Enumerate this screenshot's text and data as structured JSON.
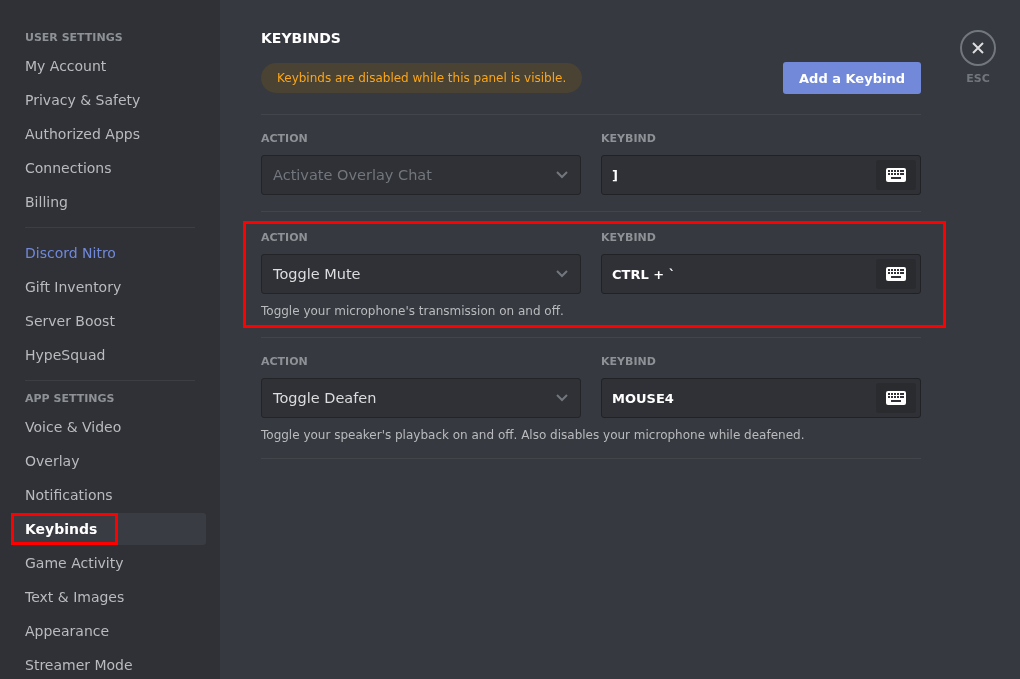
{
  "sidebar": {
    "sections": [
      {
        "header": "USER SETTINGS",
        "items": [
          {
            "label": "My Account",
            "kind": "normal",
            "selected": false,
            "highlighted": false
          },
          {
            "label": "Privacy & Safety",
            "kind": "normal",
            "selected": false,
            "highlighted": false
          },
          {
            "label": "Authorized Apps",
            "kind": "normal",
            "selected": false,
            "highlighted": false
          },
          {
            "label": "Connections",
            "kind": "normal",
            "selected": false,
            "highlighted": false
          },
          {
            "label": "Billing",
            "kind": "normal",
            "selected": false,
            "highlighted": false
          }
        ]
      },
      {
        "items": [
          {
            "label": "Discord Nitro",
            "kind": "accent",
            "selected": false,
            "highlighted": false
          },
          {
            "label": "Gift Inventory",
            "kind": "normal",
            "selected": false,
            "highlighted": false
          },
          {
            "label": "Server Boost",
            "kind": "normal",
            "selected": false,
            "highlighted": false
          },
          {
            "label": "HypeSquad",
            "kind": "normal",
            "selected": false,
            "highlighted": false
          }
        ]
      },
      {
        "header": "APP SETTINGS",
        "items": [
          {
            "label": "Voice & Video",
            "kind": "normal",
            "selected": false,
            "highlighted": false
          },
          {
            "label": "Overlay",
            "kind": "normal",
            "selected": false,
            "highlighted": false
          },
          {
            "label": "Notifications",
            "kind": "normal",
            "selected": false,
            "highlighted": false
          },
          {
            "label": "Keybinds",
            "kind": "normal",
            "selected": true,
            "highlighted": true
          },
          {
            "label": "Game Activity",
            "kind": "normal",
            "selected": false,
            "highlighted": false
          },
          {
            "label": "Text & Images",
            "kind": "normal",
            "selected": false,
            "highlighted": false
          },
          {
            "label": "Appearance",
            "kind": "normal",
            "selected": false,
            "highlighted": false
          },
          {
            "label": "Streamer Mode",
            "kind": "normal",
            "selected": false,
            "highlighted": false
          }
        ]
      }
    ]
  },
  "page": {
    "title": "KEYBINDS",
    "warning": "Keybinds are disabled while this panel is visible.",
    "add_button": "Add a Keybind"
  },
  "keybinds": [
    {
      "action_label": "ACTION",
      "action": "Activate Overlay Chat",
      "disabled": true,
      "keybind_label": "KEYBIND",
      "keybind": "]",
      "highlighted": false
    },
    {
      "action_label": "ACTION",
      "action": "Toggle Mute",
      "disabled": false,
      "keybind_label": "KEYBIND",
      "keybind": "CTRL + `",
      "description": "Toggle your microphone's transmission on and off.",
      "highlighted": true
    },
    {
      "action_label": "ACTION",
      "action": "Toggle Deafen",
      "disabled": false,
      "keybind_label": "KEYBIND",
      "keybind": "MOUSE4",
      "description": "Toggle your speaker's playback on and off. Also disables your microphone while deafened.",
      "highlighted": false
    }
  ],
  "close": {
    "label": "ESC"
  }
}
